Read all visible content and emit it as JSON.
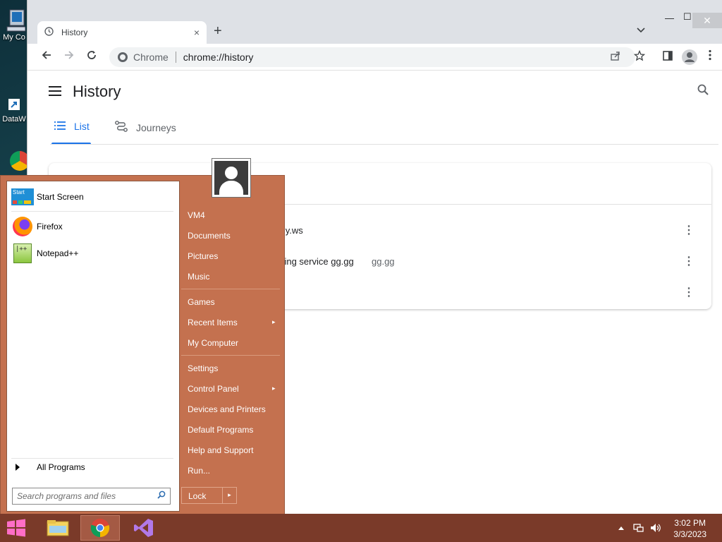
{
  "desktop": {
    "icons": [
      {
        "label": "My Co"
      },
      {
        "label": "DataW"
      }
    ]
  },
  "chrome": {
    "tab": {
      "title": "History",
      "close": "×"
    },
    "new_tab": "+",
    "tab_search": "⌄",
    "window": {
      "minimize": "—",
      "maximize": "☐",
      "close": "✕"
    },
    "toolbar": {
      "chip": "Chrome",
      "url": "chrome://history"
    }
  },
  "history": {
    "title": "History",
    "tabs": [
      {
        "label": "List"
      },
      {
        "label": "Journeys"
      }
    ],
    "rows": [
      {
        "title": "ily.ws",
        "domain": ""
      },
      {
        "title": "ening service gg.gg",
        "domain": "gg.gg"
      },
      {
        "title": "",
        "domain": ""
      }
    ]
  },
  "start_menu": {
    "pinned": [
      {
        "label": "Start Screen"
      },
      {
        "label": "Firefox"
      },
      {
        "label": "Notepad++"
      }
    ],
    "start_tile_text": "Start",
    "all_programs": "All Programs",
    "search_placeholder": "Search programs and files",
    "right_items": [
      {
        "label": "VM4"
      },
      {
        "label": "Documents"
      },
      {
        "label": "Pictures"
      },
      {
        "label": "Music"
      },
      {
        "label": "Games"
      },
      {
        "label": "Recent Items",
        "submenu": "▸"
      },
      {
        "label": "My Computer"
      },
      {
        "label": "Settings"
      },
      {
        "label": "Control Panel",
        "submenu": "▸"
      },
      {
        "label": "Devices and Printers"
      },
      {
        "label": "Default Programs"
      },
      {
        "label": "Help and Support"
      },
      {
        "label": "Run..."
      }
    ],
    "lock": {
      "label": "Lock",
      "arrow": "▸"
    }
  },
  "taskbar": {
    "clock": {
      "time": "3:02 PM",
      "date": "3/3/2023"
    }
  },
  "colors": {
    "start_menu_bg": "#c4714f",
    "taskbar_bg": "#7a3a29",
    "chrome_accent": "#1a73e8"
  }
}
